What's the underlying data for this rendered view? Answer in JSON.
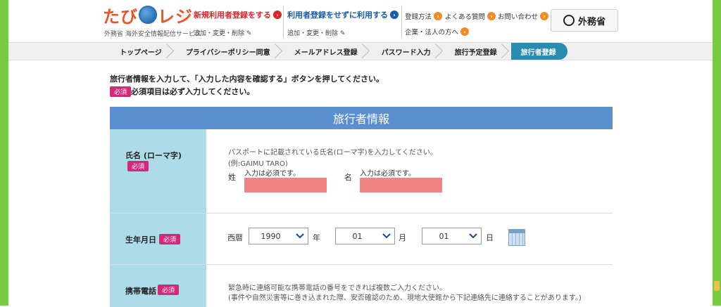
{
  "header": {
    "logo_text_1": "たび",
    "logo_text_2": "レジ",
    "logo_sub": "外務省 海外安全情報配信サービス",
    "new_user_link": "新規利用者登録をする",
    "new_user_sub": "追加・変更・削除",
    "no_register_link": "利用者登録をせずに利用する",
    "no_register_sub": "追加・変更・削除",
    "how_to": "登録方法",
    "faq": "よくある質問",
    "contact": "お問い合わせ",
    "corporate": "企業・法人の方へ",
    "mofa": "外務省"
  },
  "breadcrumb": [
    "トップページ",
    "プライバシーポリシー同意",
    "メールアドレス登録",
    "パスワード入力",
    "旅行予定登録",
    "旅行者登録"
  ],
  "instructions": {
    "line1": "旅行者情報を入力して、「入力した内容を確認する」ボタンを押してください。",
    "required_badge": "必須",
    "line2": "必須項目は必ず入力してください。"
  },
  "form": {
    "title": "旅行者情報",
    "name": {
      "label": "氏名 (ローマ字)",
      "badge": "必須",
      "help1": "パスポートに記載されている氏名(ローマ字)を入力してください。",
      "help2": "(例:GAIMU TARO)",
      "last_label": "姓",
      "first_label": "名",
      "last_error": "入力は必須です。",
      "first_error": "入力は必須です。"
    },
    "birth": {
      "label": "生年月日",
      "badge": "必須",
      "era": "西暦",
      "year": "1990",
      "year_unit": "年",
      "month": "01",
      "month_unit": "月",
      "day": "01",
      "day_unit": "日"
    },
    "mobile": {
      "label": "携帯電話",
      "badge": "必須",
      "help1": "緊急時に連絡可能な携帯電話の番号をできれば複数ご入力ください。",
      "help2": "(事件や自然災害等に巻き込まれた際、安否確認のため、現地大使館から下記連絡先に連絡することがあります。)"
    }
  },
  "colors": {
    "accent_blue": "#5b8fd1",
    "label_bg": "#acdbe9",
    "required_pink": "#d8267a",
    "error_fill": "#f28383",
    "crumb_active": "#2a8bb0"
  }
}
